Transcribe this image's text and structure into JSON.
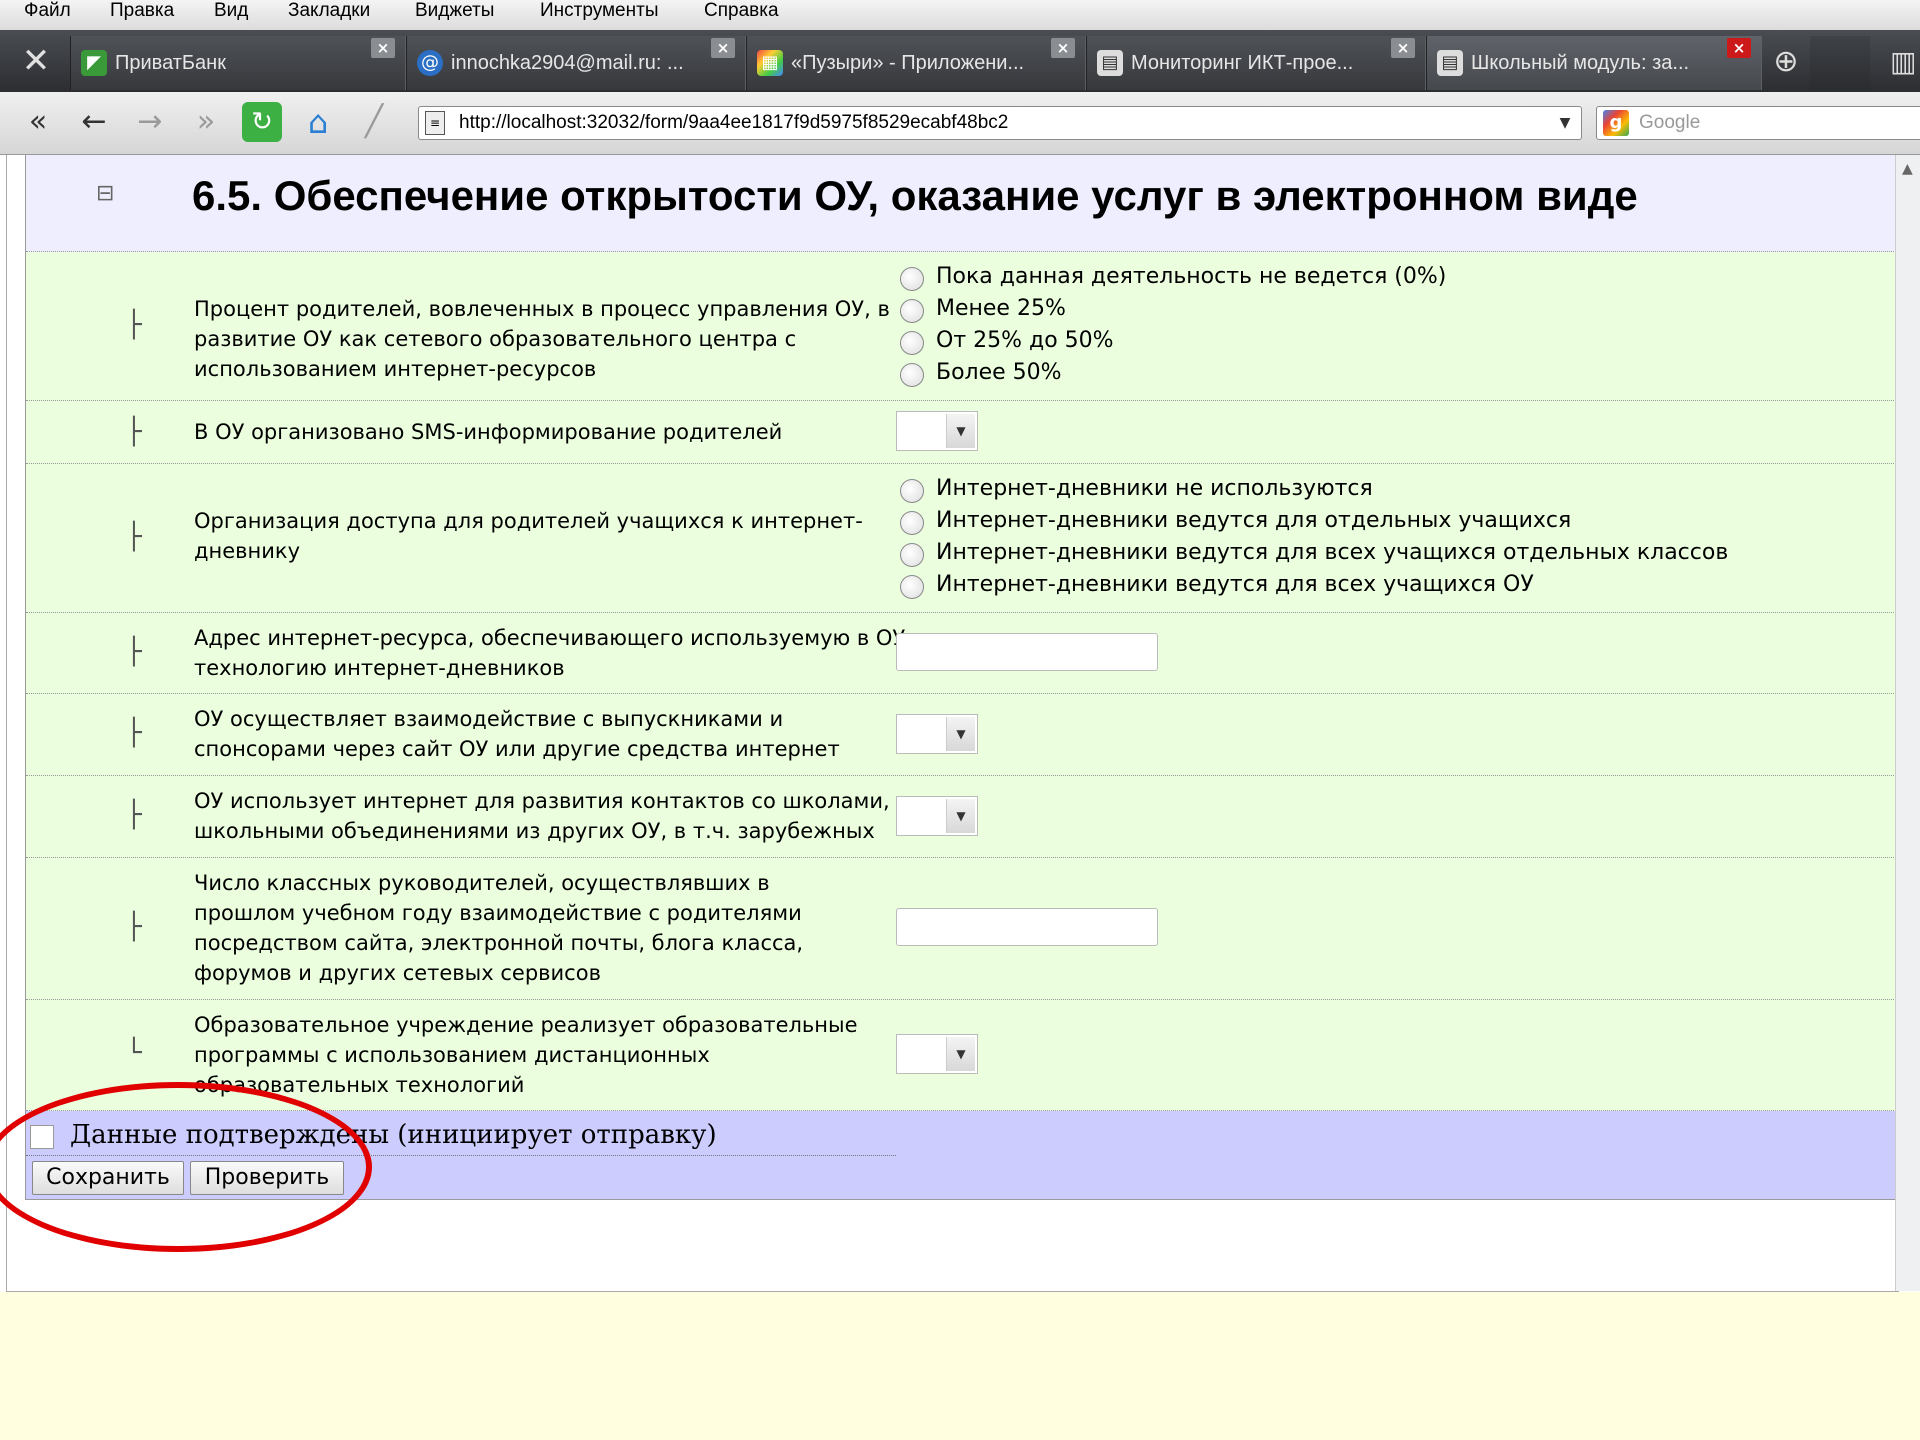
{
  "menu": [
    "Файл",
    "Правка",
    "Вид",
    "Закладки",
    "Виджеты",
    "Инструменты",
    "Справка"
  ],
  "tabs": [
    {
      "label": "ПриватБанк",
      "icon": "privatbank-icon",
      "active": false
    },
    {
      "label": "innochka2904@mail.ru: ...",
      "icon": "mail-icon",
      "active": false
    },
    {
      "label": "«Пузыри» - Приложени...",
      "icon": "app-icon",
      "active": false
    },
    {
      "label": "Мониторинг ИКТ-прое...",
      "icon": "page-icon",
      "active": false
    },
    {
      "label": "Школьный модуль: за...",
      "icon": "page-icon",
      "active": true
    }
  ],
  "address": {
    "url": "http://localhost:32032/form/9aa4ee1817f9d5975f8529ecabf48bc2",
    "search_placeholder": "Google"
  },
  "section": {
    "title": "6.5. Обеспечение открытости ОУ, оказание услуг в электронном виде"
  },
  "questions": [
    {
      "text": "Процент родителей, вовлеченных в процесс управления ОУ, в развитие ОУ как сетевого образовательного центра с использованием интернет-ресурсов",
      "control": "radio",
      "options": [
        "Пока данная деятельность не ведется (0%)",
        "Менее 25%",
        "От 25% до 50%",
        "Более 50%"
      ]
    },
    {
      "text": "В ОУ организовано SMS-информирование родителей",
      "control": "select",
      "value": ""
    },
    {
      "text": "Организация доступа для родителей учащихся к интернет-дневнику",
      "control": "radio",
      "options": [
        "Интернет-дневники не используются",
        "Интернет-дневники ведутся для отдельных учащихся",
        "Интернет-дневники ведутся для всех учащихся отдельных классов",
        "Интернет-дневники ведутся для всех учащихся ОУ"
      ]
    },
    {
      "text": "Адрес интернет-ресурса, обеспечивающего используемую в ОУ технологию интернет-дневников",
      "control": "text",
      "value": ""
    },
    {
      "text": "ОУ осуществляет взаимодействие с выпускниками и спонсорами через сайт ОУ или другие средства интернет",
      "control": "select",
      "value": ""
    },
    {
      "text": "ОУ использует интернет для развития контактов со школами, школьными объединениями из других ОУ, в т.ч. зарубежных",
      "control": "select",
      "value": ""
    },
    {
      "text": "Число классных руководителей, осуществлявших в прошлом учебном году взаимодействие с родителями посредством сайта, электронной почты, блога класса, форумов и других сетевых сервисов",
      "control": "text",
      "value": ""
    },
    {
      "text": "Образовательное учреждение реализует образовательные программы с использованием дистанционных образовательных технологий",
      "control": "select",
      "value": ""
    }
  ],
  "confirm": {
    "label": "Данные подтверждены (инициирует отправку)",
    "checked": false
  },
  "buttons": {
    "save": "Сохранить",
    "check": "Проверить"
  },
  "colors": {
    "form_bg": "#ebffdf",
    "header_bg": "#eeeeff",
    "confirm_bg": "#ccccff",
    "page_bg": "#ffffe0",
    "highlight": "#e00000"
  }
}
